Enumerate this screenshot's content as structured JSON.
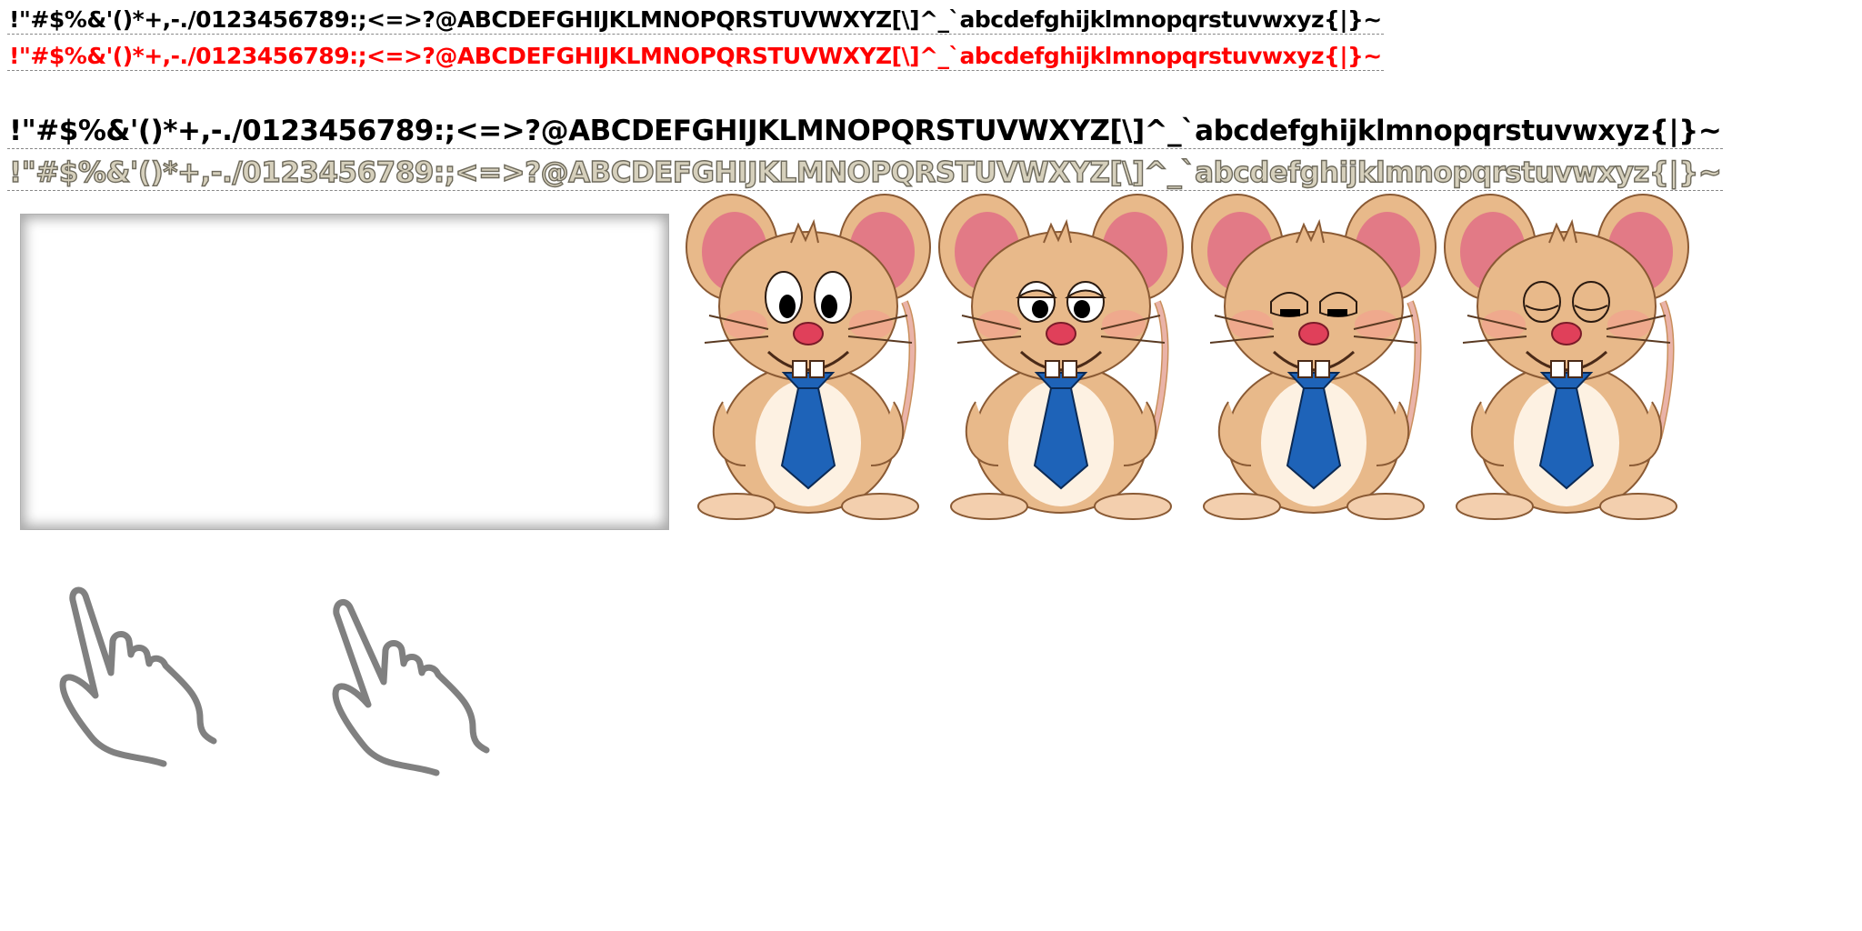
{
  "glyph_rows": [
    {
      "name": "small-black",
      "text": "!\"#$%&'()*+,-./0123456789:;<=>?@ABCDEFGHIJKLMNOPQRSTUVWXYZ[\\]^_`abcdefghijklmnopqrstuvwxyz{|}~",
      "color": "#000000"
    },
    {
      "name": "small-red",
      "text": "!\"#$%&'()*+,-./0123456789:;<=>?@ABCDEFGHIJKLMNOPQRSTUVWXYZ[\\]^_`abcdefghijklmnopqrstuvwxyz{|}~",
      "color": "#ff0000"
    },
    {
      "name": "large-black",
      "text": "!\"#$%&'()*+,-./0123456789:;<=>?@ABCDEFGHIJKLMNOPQRSTUVWXYZ[\\]^_`abcdefghijklmnopqrstuvwxyz{|}~",
      "color": "#000000"
    },
    {
      "name": "large-metal",
      "text": "!\"#$%&'()*+,-./0123456789:;<=>?@ABCDEFGHIJKLMNOPQRSTUVWXYZ[\\]^_`abcdefghijklmnopqrstuvwxyz{|}~",
      "color": "#d6d0bc"
    }
  ],
  "sprites": [
    {
      "icon": "mouse-eyes-open-icon"
    },
    {
      "icon": "mouse-eyes-half-icon"
    },
    {
      "icon": "mouse-eyes-squint-icon"
    },
    {
      "icon": "mouse-eyes-closed-icon"
    }
  ],
  "cursors": [
    {
      "icon": "pointing-hand-icon"
    },
    {
      "icon": "pointing-hand-icon"
    }
  ],
  "colors": {
    "fur": "#e8b98a",
    "fur_dark": "#c98f5c",
    "belly": "#fdf1e2",
    "ear_inner": "#e27a86",
    "tie": "#1e63b8",
    "nose": "#e0405a",
    "hand_stroke": "#808080"
  }
}
